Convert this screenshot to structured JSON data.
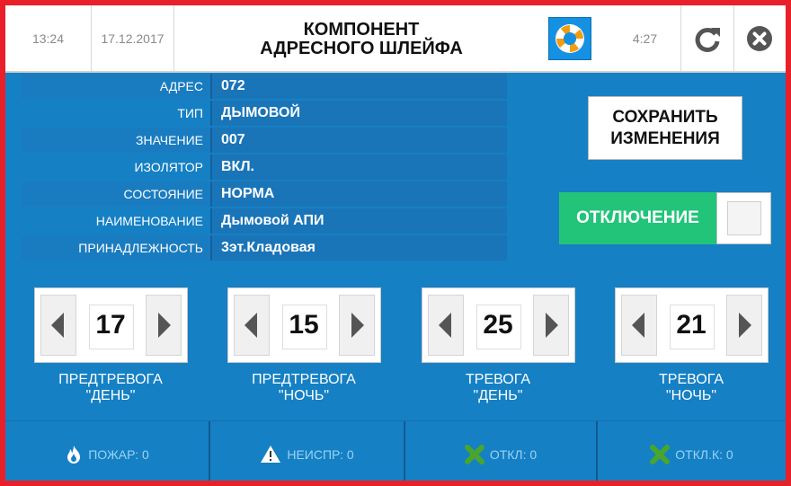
{
  "header": {
    "time": "13:24",
    "date": "17.12.2017",
    "title_line1": "КОМПОНЕНТ",
    "title_line2": "АДРЕСНОГО ШЛЕЙФА",
    "timer": "4:27",
    "help_icon": "lifebuoy-icon",
    "refresh_icon": "refresh-icon",
    "close_icon": "close-circle-icon"
  },
  "info": [
    {
      "label": "АДРЕС",
      "value": "072"
    },
    {
      "label": "ТИП",
      "value": "ДЫМОВОЙ"
    },
    {
      "label": "ЗНАЧЕНИЕ",
      "value": "007"
    },
    {
      "label": "ИЗОЛЯТОР",
      "value": "ВКЛ."
    },
    {
      "label": "СОСТОЯНИЕ",
      "value": "НОРМА"
    },
    {
      "label": "НАИМЕНОВАНИЕ",
      "value": "Дымовой АПИ"
    },
    {
      "label": "ПРИНАДЛЕЖНОСТЬ",
      "value": "3эт.Кладовая"
    }
  ],
  "save_button": {
    "line1": "СОХРАНИТЬ",
    "line2": "ИЗМЕНЕНИЯ"
  },
  "disable": {
    "label": "ОТКЛЮЧЕНИЕ",
    "checked": false
  },
  "steppers": [
    {
      "value": "17",
      "label1": "ПРЕДТРЕВОГА",
      "label2": "\"ДЕНЬ\""
    },
    {
      "value": "15",
      "label1": "ПРЕДТРЕВОГА",
      "label2": "\"НОЧЬ\""
    },
    {
      "value": "25",
      "label1": "ТРЕВОГА",
      "label2": "\"ДЕНЬ\""
    },
    {
      "value": "21",
      "label1": "ТРЕВОГА",
      "label2": "\"НОЧЬ\""
    }
  ],
  "status": [
    {
      "icon": "fire-icon",
      "label": "ПОЖАР: 0"
    },
    {
      "icon": "warning-icon",
      "label": "НЕИСПР: 0"
    },
    {
      "icon": "cross-icon",
      "label": "ОТКЛ: 0"
    },
    {
      "icon": "cross-icon",
      "label": "ОТКЛ.К: 0"
    }
  ],
  "colors": {
    "border": "#e8202a",
    "panel": "#1580c4",
    "disable_green": "#22c47a",
    "status_text": "#9cd2f5",
    "cross_green": "#4aa52e"
  }
}
